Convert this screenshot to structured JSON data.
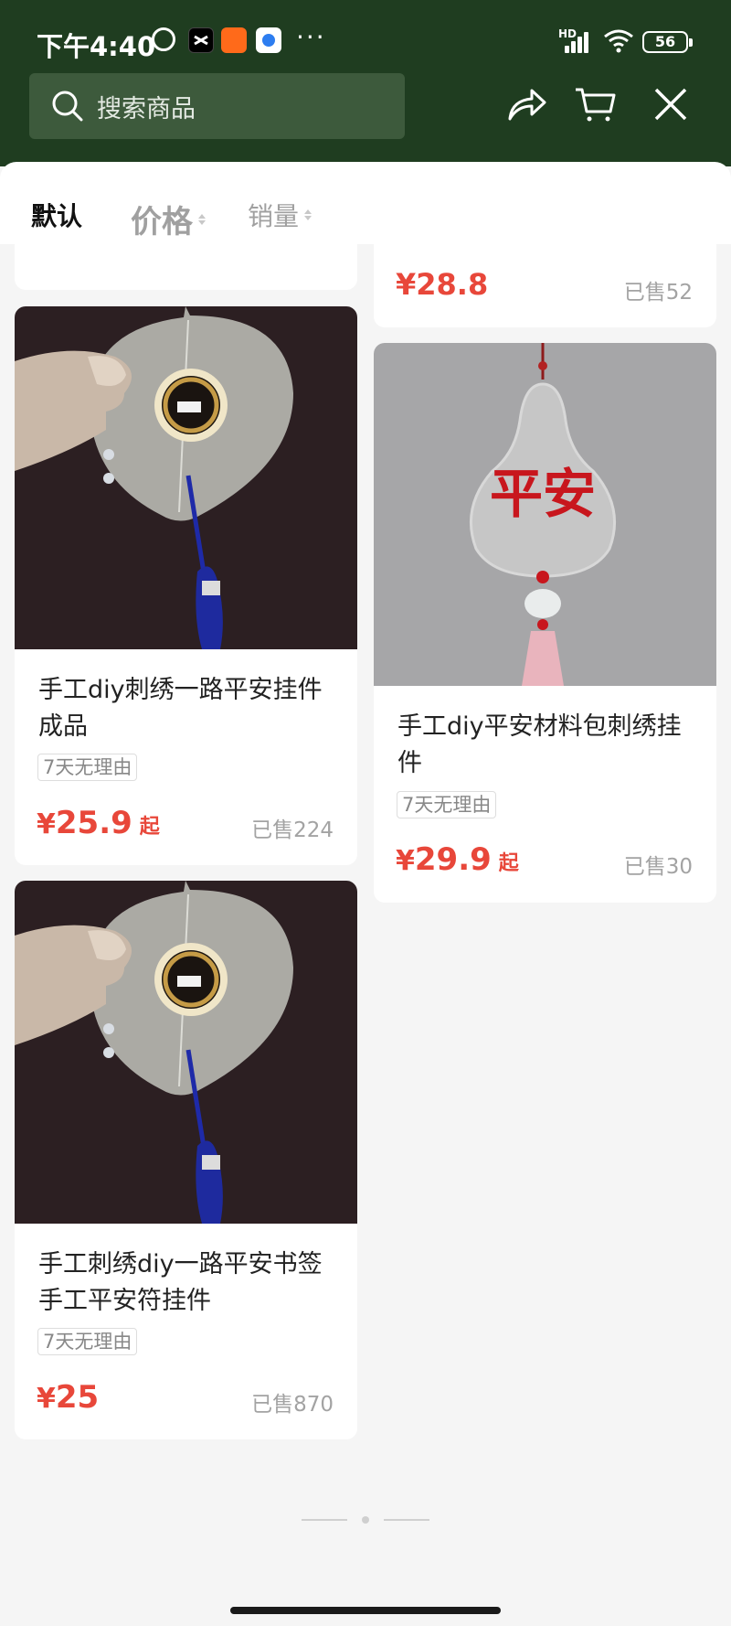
{
  "status_bar": {
    "time": "下午4:40",
    "battery": "56",
    "network": "HD"
  },
  "search": {
    "placeholder": "搜索商品"
  },
  "sort": {
    "default": "默认",
    "price": "价格",
    "sales": "销量"
  },
  "partial_card_right": {
    "price": "¥28.8",
    "sold": "已售52"
  },
  "products": [
    {
      "title": "手工diy刺绣一路平安挂件成品",
      "tag": "7天无理由",
      "price_yen": "¥",
      "price_value": "25.9",
      "price_suffix": "起",
      "sold": "已售224"
    },
    {
      "title": "手工diy平安材料包刺绣挂件",
      "tag": "7天无理由",
      "price_yen": "¥",
      "price_value": "29.9",
      "price_suffix": "起",
      "sold": "已售30",
      "image_text": "平安"
    },
    {
      "title": "手工刺绣diy一路平安书签手工平安符挂件",
      "tag": "7天无理由",
      "price_yen": "¥",
      "price_value": "25",
      "price_suffix": "",
      "sold": "已售870"
    }
  ],
  "colors": {
    "header_bg": "#1f3d20",
    "price": "#e8473a",
    "page_bg": "#f5f5f5"
  }
}
